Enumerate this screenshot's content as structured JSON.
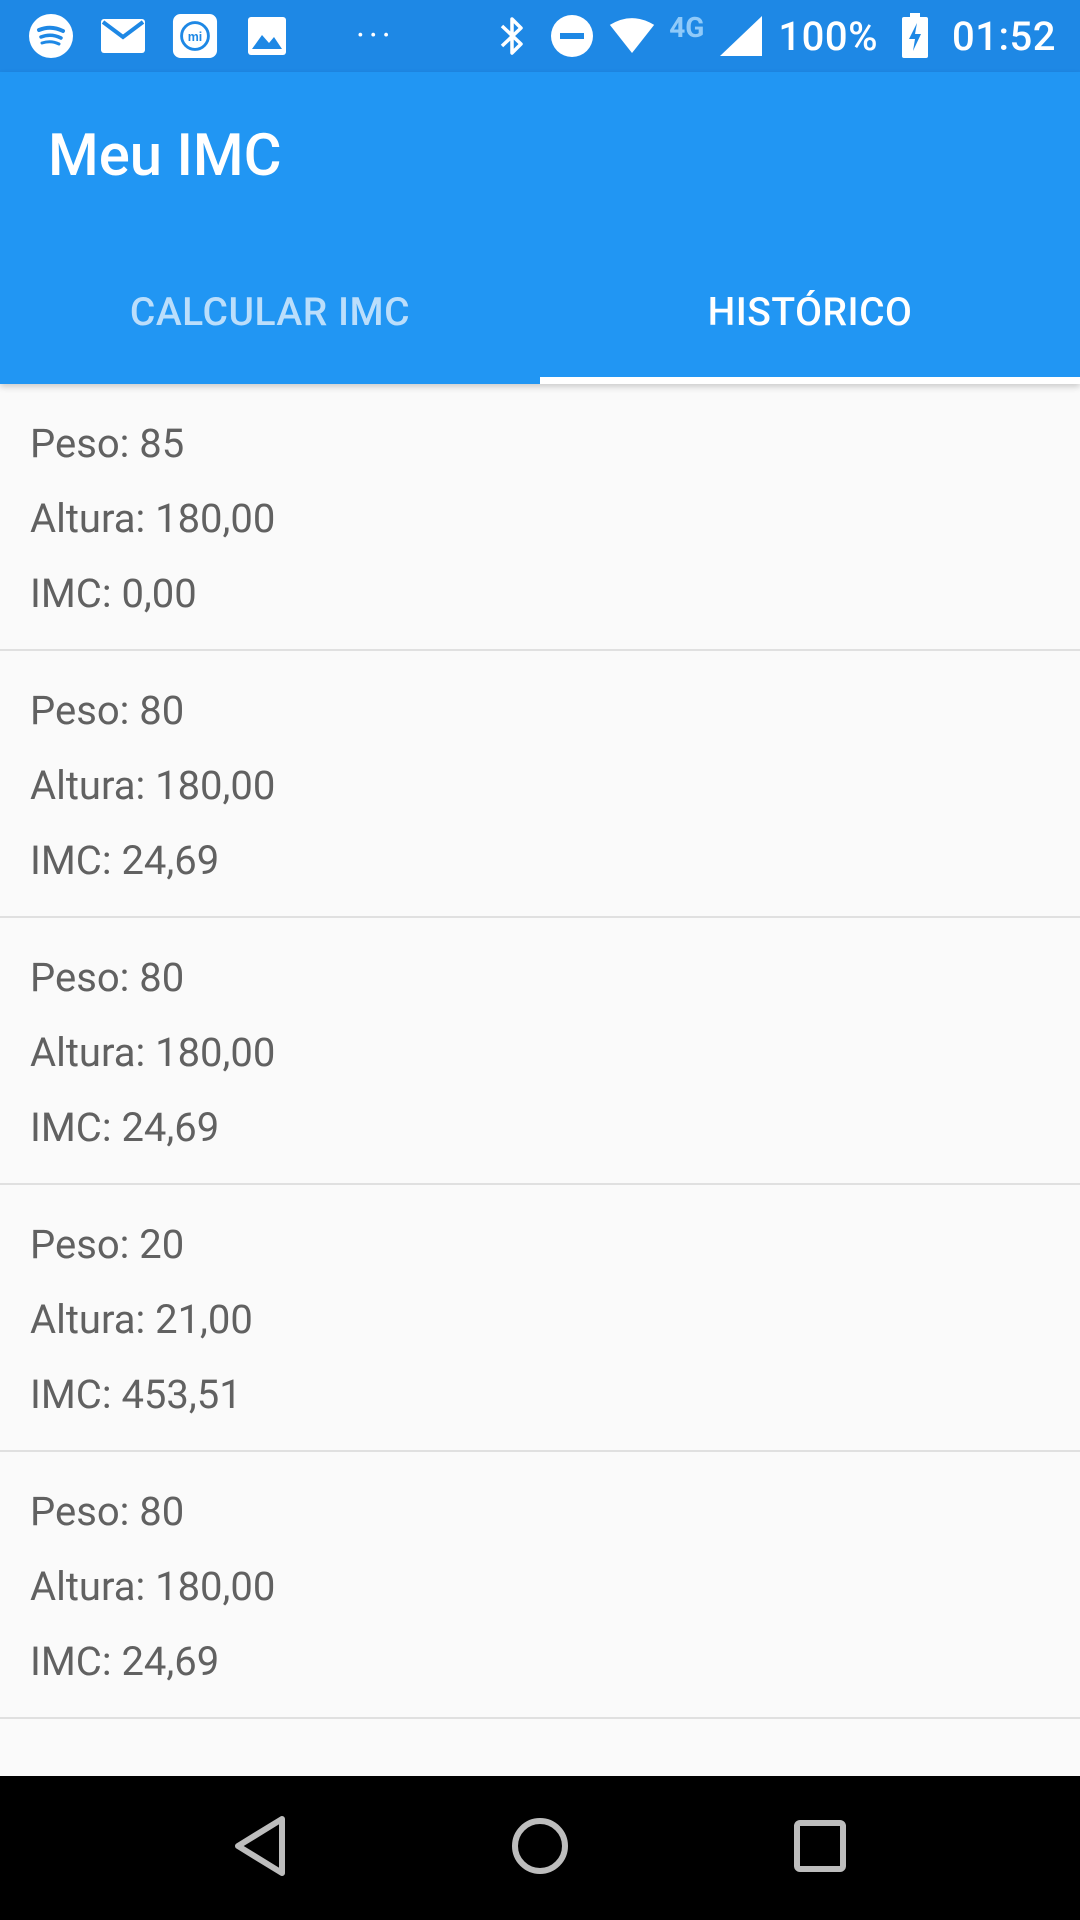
{
  "status_bar": {
    "battery": "100%",
    "time": "01:52",
    "network": "4G",
    "icons": [
      "spotify-icon",
      "mail-icon",
      "mi-fit-icon",
      "gallery-icon",
      "more-dots-icon",
      "bluetooth-icon",
      "do-not-disturb-icon",
      "wifi-icon",
      "signal-icon",
      "battery-charging-icon"
    ],
    "dots": "···"
  },
  "app_bar": {
    "title": "Meu IMC",
    "background_color": "#2196f3"
  },
  "tabs": [
    {
      "label": "CALCULAR IMC",
      "active": false
    },
    {
      "label": "HISTÓRICO",
      "active": true
    }
  ],
  "history": [
    {
      "peso": "Peso: 85",
      "altura": "Altura: 180,00",
      "imc": "IMC: 0,00"
    },
    {
      "peso": "Peso: 80",
      "altura": "Altura: 180,00",
      "imc": "IMC: 24,69"
    },
    {
      "peso": "Peso: 80",
      "altura": "Altura: 180,00",
      "imc": "IMC: 24,69"
    },
    {
      "peso": "Peso: 20",
      "altura": "Altura: 21,00",
      "imc": "IMC: 453,51"
    },
    {
      "peso": "Peso: 80",
      "altura": "Altura: 180,00",
      "imc": "IMC: 24,69"
    }
  ],
  "nav_bar": {
    "icons": [
      "back-icon",
      "home-icon",
      "recents-icon"
    ]
  }
}
